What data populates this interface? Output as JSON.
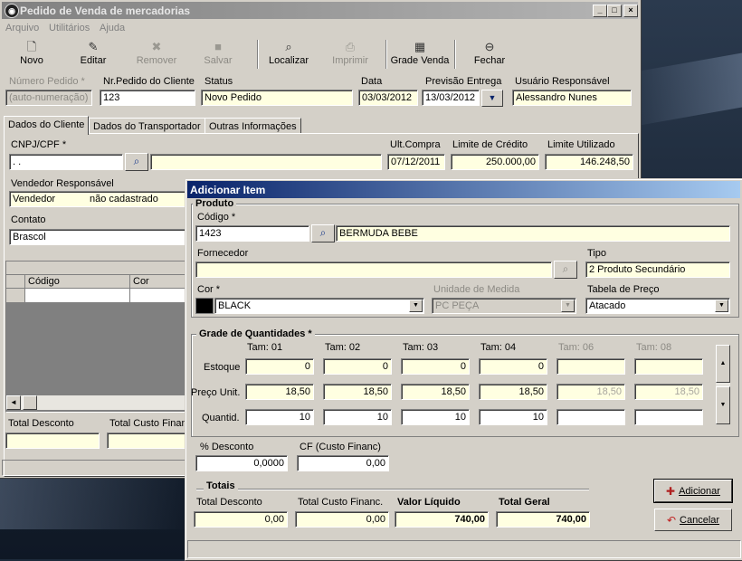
{
  "main": {
    "title": "Pedido de Venda de mercadorias",
    "menu": [
      "Arquivo",
      "Utilitários",
      "Ajuda"
    ],
    "toolbar": {
      "novo": "Novo",
      "editar": "Editar",
      "remover": "Remover",
      "salvar": "Salvar",
      "localizar": "Localizar",
      "imprimir": "Imprimir",
      "grade_venda": "Grade Venda",
      "fechar": "Fechar"
    },
    "header_fields": {
      "numero_pedido_label": "Número Pedido *",
      "numero_pedido_value": "(auto-numeração)",
      "nr_pedido_cliente_label": "Nr.Pedido do Cliente",
      "nr_pedido_cliente_value": "123",
      "status_label": "Status",
      "status_value": "Novo Pedido",
      "data_label": "Data",
      "data_value": "03/03/2012",
      "previsao_label": "Previsão Entrega",
      "previsao_value": "13/03/2012",
      "usuario_label": "Usuário Responsável",
      "usuario_value": "Alessandro Nunes"
    },
    "tabs": [
      "Dados do Cliente",
      "Dados do Transportador",
      "Outras Informações"
    ],
    "cliente": {
      "cnpj_label": "CNPJ/CPF *",
      "cnpj_value": "  .    .   ",
      "ult_compra_label": "Ult.Compra",
      "ult_compra_value": "07/12/2011",
      "limite_credito_label": "Limite de Crédito",
      "limite_credito_value": "250.000,00",
      "limite_utilizado_label": "Limite Utilizado",
      "limite_utilizado_value": "146.248,50",
      "vendedor_label": "Vendedor Responsável",
      "vendedor_value": "Vendedor",
      "vendedor_extra": "não cadastrado",
      "contato_label": "Contato",
      "contato_value": "Brascol"
    },
    "grid": {
      "col_codigo": "Código",
      "col_cor": "Cor"
    },
    "totals": {
      "total_desconto": "Total Desconto",
      "total_custo": "Total Custo Financ"
    }
  },
  "dialog": {
    "title": "Adicionar Item",
    "produto_group": "Produto",
    "codigo_label": "Código *",
    "codigo_value": "1423",
    "produto_desc": "BERMUDA BEBE",
    "fornecedor_label": "Fornecedor",
    "fornecedor_value": "",
    "tipo_label": "Tipo",
    "tipo_value": "2 Produto Secundário",
    "cor_label": "Cor *",
    "cor_value": "BLACK",
    "cor_swatch": "#000000",
    "unidade_label": "Unidade de Medida",
    "unidade_value": "PC PEÇA",
    "tabela_label": "Tabela de Preço",
    "tabela_value": "Atacado",
    "grade_group": "Grade de Quantidades *",
    "row_labels": {
      "estoque": "Estoque",
      "preco": "Preço Unit.",
      "quantid": "Quantid."
    },
    "sizes": [
      {
        "label": "Tam: 01",
        "estoque": "0",
        "preco": "18,50",
        "quantid": "10",
        "enabled": true
      },
      {
        "label": "Tam: 02",
        "estoque": "0",
        "preco": "18,50",
        "quantid": "10",
        "enabled": true
      },
      {
        "label": "Tam: 03",
        "estoque": "0",
        "preco": "18,50",
        "quantid": "10",
        "enabled": true
      },
      {
        "label": "Tam: 04",
        "estoque": "0",
        "preco": "18,50",
        "quantid": "10",
        "enabled": true
      },
      {
        "label": "Tam: 06",
        "estoque": "",
        "preco": "18,50",
        "quantid": "",
        "enabled": false
      },
      {
        "label": "Tam: 08",
        "estoque": "",
        "preco": "18,50",
        "quantid": "",
        "enabled": false
      }
    ],
    "desconto_label": "% Desconto",
    "desconto_value": "0,0000",
    "cf_label": "CF (Custo Financ)",
    "cf_value": "0,00",
    "totais_group": "Totais",
    "total_desconto_label": "Total Desconto",
    "total_desconto_value": "0,00",
    "total_custo_label": "Total Custo Financ.",
    "total_custo_value": "0,00",
    "valor_liquido_label": "Valor Líquido",
    "valor_liquido_value": "740,00",
    "total_geral_label": "Total Geral",
    "total_geral_value": "740,00",
    "adicionar_label": "Adicionar",
    "cancelar_label": "Cancelar"
  }
}
